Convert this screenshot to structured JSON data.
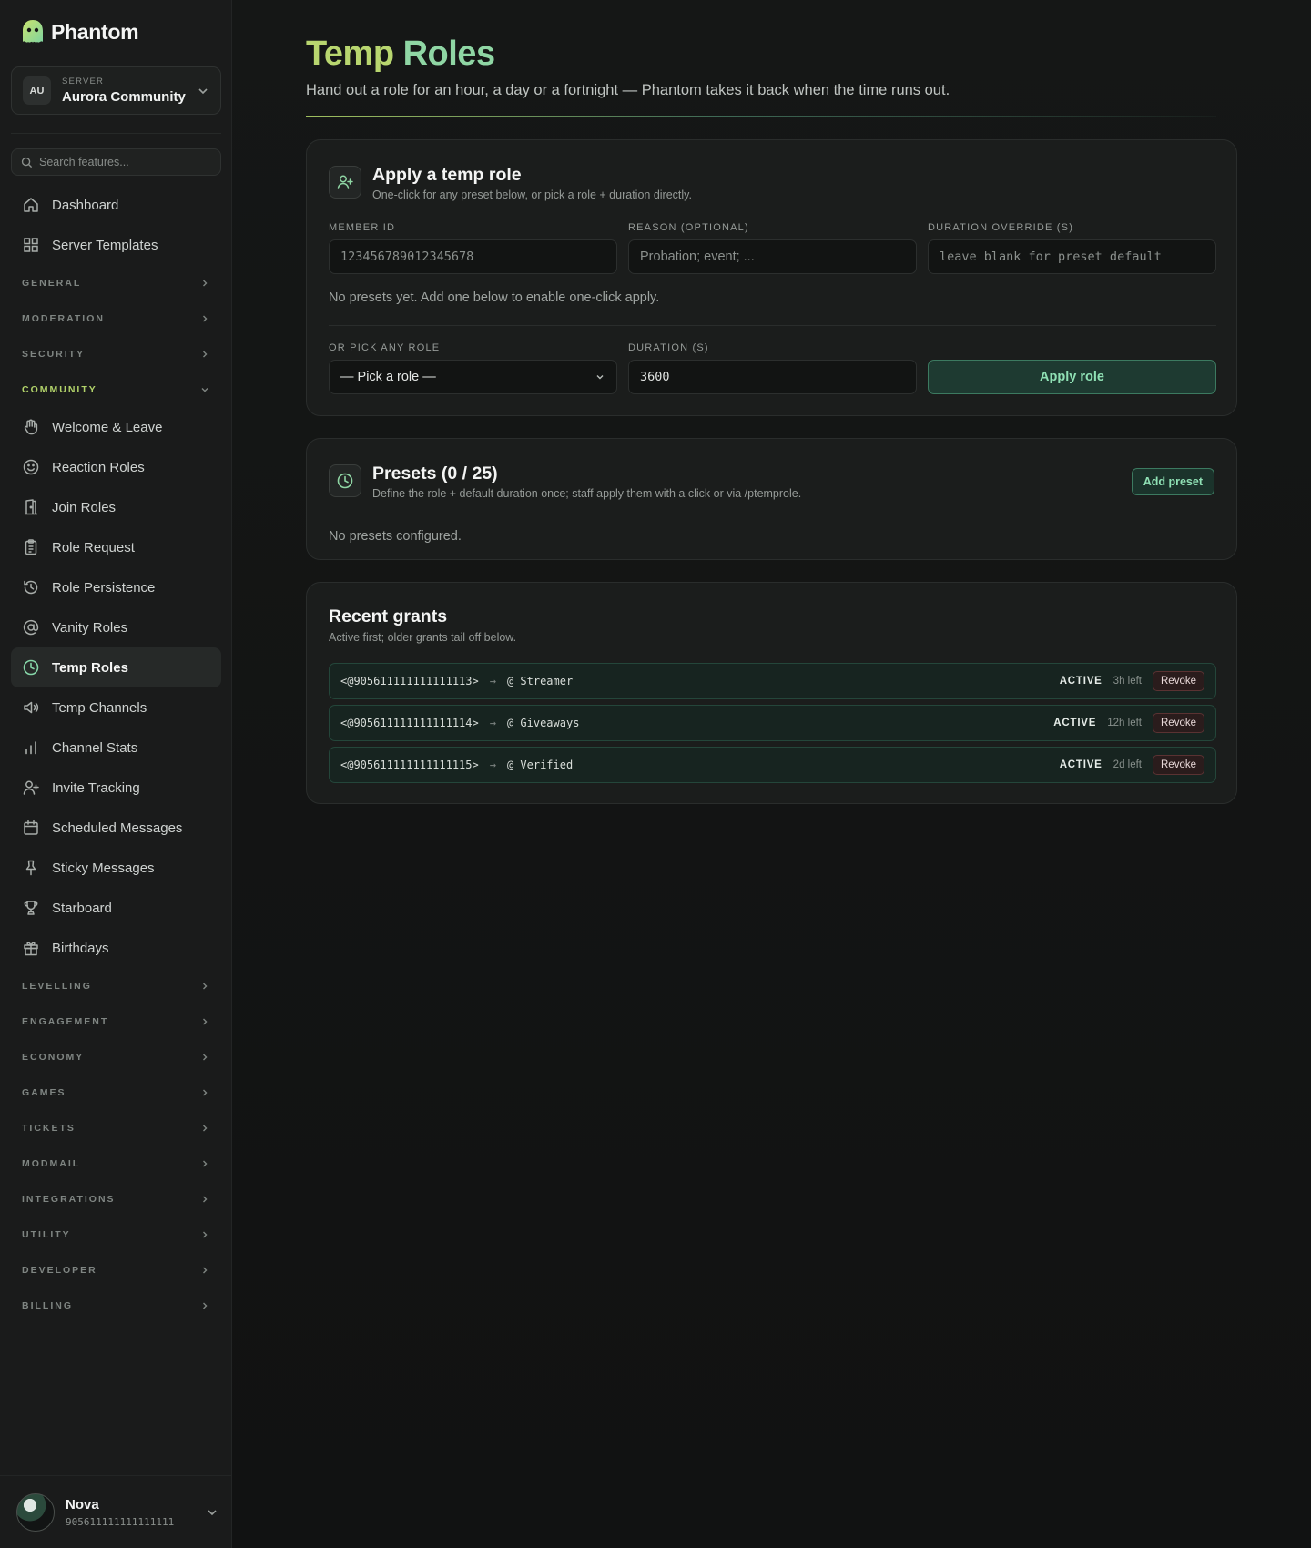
{
  "brand": {
    "name": "Phantom"
  },
  "server": {
    "avatar": "AU",
    "caption": "SERVER",
    "name": "Aurora Community"
  },
  "search": {
    "placeholder": "Search features..."
  },
  "nav": {
    "top": [
      {
        "label": "Dashboard",
        "icon": "home-icon"
      },
      {
        "label": "Server Templates",
        "icon": "grid-icon"
      }
    ],
    "sections_before": [
      "GENERAL",
      "MODERATION",
      "SECURITY"
    ],
    "open_section": "COMMUNITY",
    "community_items": [
      {
        "label": "Welcome & Leave",
        "icon": "hand-icon"
      },
      {
        "label": "Reaction Roles",
        "icon": "smile-icon"
      },
      {
        "label": "Join Roles",
        "icon": "door-icon"
      },
      {
        "label": "Role Request",
        "icon": "clipboard-icon"
      },
      {
        "label": "Role Persistence",
        "icon": "history-icon"
      },
      {
        "label": "Vanity Roles",
        "icon": "at-sign-icon"
      },
      {
        "label": "Temp Roles",
        "icon": "clock-icon",
        "active": true
      },
      {
        "label": "Temp Channels",
        "icon": "speaker-icon"
      },
      {
        "label": "Channel Stats",
        "icon": "bar-chart-icon"
      },
      {
        "label": "Invite Tracking",
        "icon": "user-plus-icon"
      },
      {
        "label": "Scheduled Messages",
        "icon": "calendar-icon"
      },
      {
        "label": "Sticky Messages",
        "icon": "pin-icon"
      },
      {
        "label": "Starboard",
        "icon": "trophy-icon"
      },
      {
        "label": "Birthdays",
        "icon": "gift-icon"
      }
    ],
    "sections_after": [
      "LEVELLING",
      "ENGAGEMENT",
      "ECONOMY",
      "GAMES",
      "TICKETS",
      "MODMAIL",
      "INTEGRATIONS",
      "UTILITY",
      "DEVELOPER",
      "BILLING"
    ]
  },
  "user": {
    "name": "Nova",
    "id": "905611111111111111"
  },
  "page": {
    "title_part1": "Temp",
    "title_part2": "Roles",
    "subtitle": "Hand out a role for an hour, a day or a fortnight — Phantom takes it back when the time runs out."
  },
  "apply_card": {
    "title": "Apply a temp role",
    "description": "One-click for any preset below, or pick a role + duration directly.",
    "member_id_label": "MEMBER ID",
    "member_id_placeholder": "123456789012345678",
    "reason_label": "REASON (OPTIONAL)",
    "reason_placeholder": "Probation; event; ...",
    "duration_override_label": "DURATION OVERRIDE (S)",
    "duration_override_placeholder": "leave blank for preset default",
    "no_presets_hint": "No presets yet. Add one below to enable one-click apply.",
    "pick_role_label": "OR PICK ANY ROLE",
    "pick_role_value": "— Pick a role —",
    "duration_label": "DURATION (S)",
    "duration_value": "3600",
    "apply_button": "Apply role"
  },
  "presets_card": {
    "title": "Presets (0 / 25)",
    "description": "Define the role + default duration once; staff apply them with a click or via /ptemprole.",
    "add_button": "Add preset",
    "empty": "No presets configured."
  },
  "grants_card": {
    "title": "Recent grants",
    "description": "Active first; older grants tail off below.",
    "rows": [
      {
        "member": "<@905611111111111113>",
        "arrow": "→",
        "role": "@ Streamer",
        "status": "ACTIVE",
        "time_left": "3h left",
        "action": "Revoke"
      },
      {
        "member": "<@905611111111111114>",
        "arrow": "→",
        "role": "@ Giveaways",
        "status": "ACTIVE",
        "time_left": "12h left",
        "action": "Revoke"
      },
      {
        "member": "<@905611111111111115>",
        "arrow": "→",
        "role": "@ Verified",
        "status": "ACTIVE",
        "time_left": "2d left",
        "action": "Revoke"
      }
    ]
  },
  "colors": {
    "accent_green": "#8fd6a4",
    "accent_lime": "#b8d66f",
    "background": "#121313",
    "revoke_red": "#5a3232"
  }
}
